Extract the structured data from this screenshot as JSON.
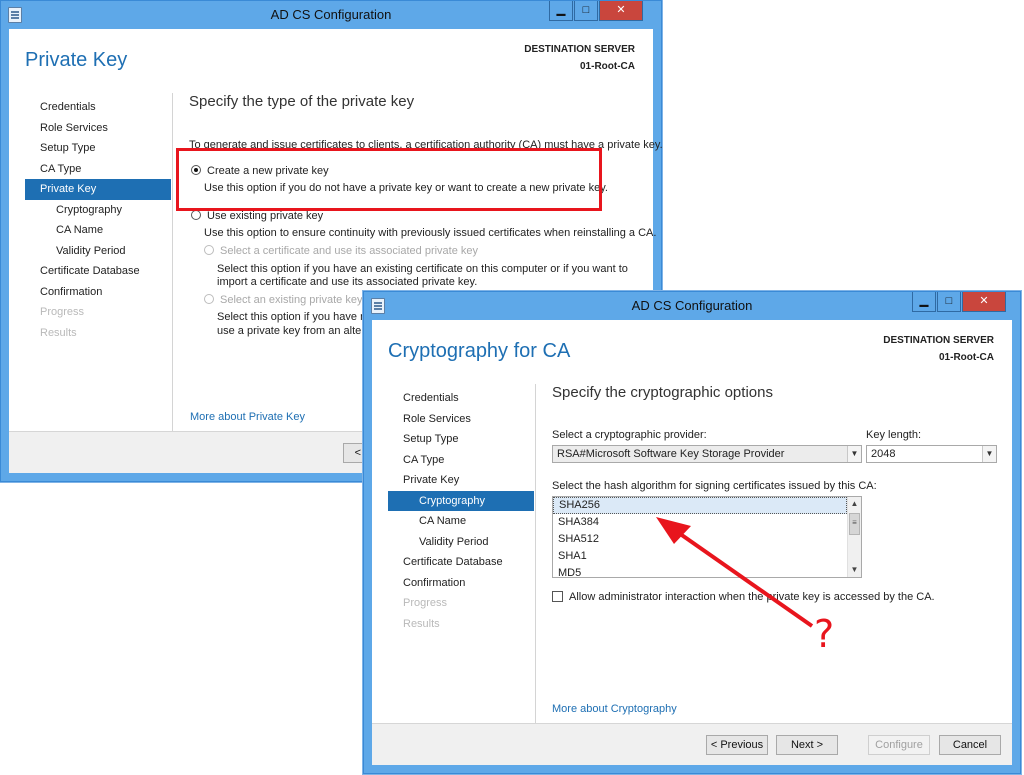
{
  "window1": {
    "title": "AD CS Configuration",
    "page_title": "Private Key",
    "dest_label": "DESTINATION SERVER",
    "dest_value": "01-Root-CA",
    "nav": [
      {
        "label": "Credentials",
        "state": "normal"
      },
      {
        "label": "Role Services",
        "state": "normal"
      },
      {
        "label": "Setup Type",
        "state": "normal"
      },
      {
        "label": "CA Type",
        "state": "normal"
      },
      {
        "label": "Private Key",
        "state": "active"
      },
      {
        "label": "Cryptography",
        "state": "sub"
      },
      {
        "label": "CA Name",
        "state": "sub"
      },
      {
        "label": "Validity Period",
        "state": "sub"
      },
      {
        "label": "Certificate Database",
        "state": "normal"
      },
      {
        "label": "Confirmation",
        "state": "normal"
      },
      {
        "label": "Progress",
        "state": "disabled"
      },
      {
        "label": "Results",
        "state": "disabled"
      }
    ],
    "section_title": "Specify the type of the private key",
    "intro": "To generate and issue certificates to clients, a certification authority (CA) must have a private key.",
    "opt_new_label": "Create a new private key",
    "opt_new_desc": "Use this option if you do not have a private key or want to create a new private key.",
    "opt_existing_label": "Use existing private key",
    "opt_existing_desc": "Use this option to ensure continuity with previously issued certificates when reinstalling a CA.",
    "sub1_label": "Select a certificate and use its associated private key",
    "sub1_desc1": "Select this option if you have an existing certificate on this computer or if you want to",
    "sub1_desc2": "import a certificate and use its associated private key.",
    "sub2_label": "Select an existing private key on",
    "sub2_desc1": "Select this option if you have reta",
    "sub2_desc2": "use a private key from an alterna",
    "more_link": "More about Private Key",
    "prev_btn_partial": "< P"
  },
  "window2": {
    "title": "AD CS Configuration",
    "page_title": "Cryptography for CA",
    "dest_label": "DESTINATION SERVER",
    "dest_value": "01-Root-CA",
    "nav": [
      {
        "label": "Credentials",
        "state": "normal"
      },
      {
        "label": "Role Services",
        "state": "normal"
      },
      {
        "label": "Setup Type",
        "state": "normal"
      },
      {
        "label": "CA Type",
        "state": "normal"
      },
      {
        "label": "Private Key",
        "state": "normal"
      },
      {
        "label": "Cryptography",
        "state": "active-sub"
      },
      {
        "label": "CA Name",
        "state": "sub"
      },
      {
        "label": "Validity Period",
        "state": "sub"
      },
      {
        "label": "Certificate Database",
        "state": "normal"
      },
      {
        "label": "Confirmation",
        "state": "normal"
      },
      {
        "label": "Progress",
        "state": "disabled"
      },
      {
        "label": "Results",
        "state": "disabled"
      }
    ],
    "section_title": "Specify the cryptographic options",
    "provider_label": "Select a cryptographic provider:",
    "provider_value": "RSA#Microsoft Software Key Storage Provider",
    "keylen_label": "Key length:",
    "keylen_value": "2048",
    "hash_label": "Select the hash algorithm for signing certificates issued by this CA:",
    "hash_options": [
      "SHA256",
      "SHA384",
      "SHA512",
      "SHA1",
      "MD5"
    ],
    "hash_selected": "SHA256",
    "admin_checkbox_label": "Allow administrator interaction when the private key is accessed by the CA.",
    "more_link": "More about Cryptography",
    "buttons": {
      "previous": "< Previous",
      "next": "Next >",
      "configure": "Configure",
      "cancel": "Cancel"
    }
  },
  "annotation": {
    "question_mark": "?",
    "color": "#e8151d"
  }
}
